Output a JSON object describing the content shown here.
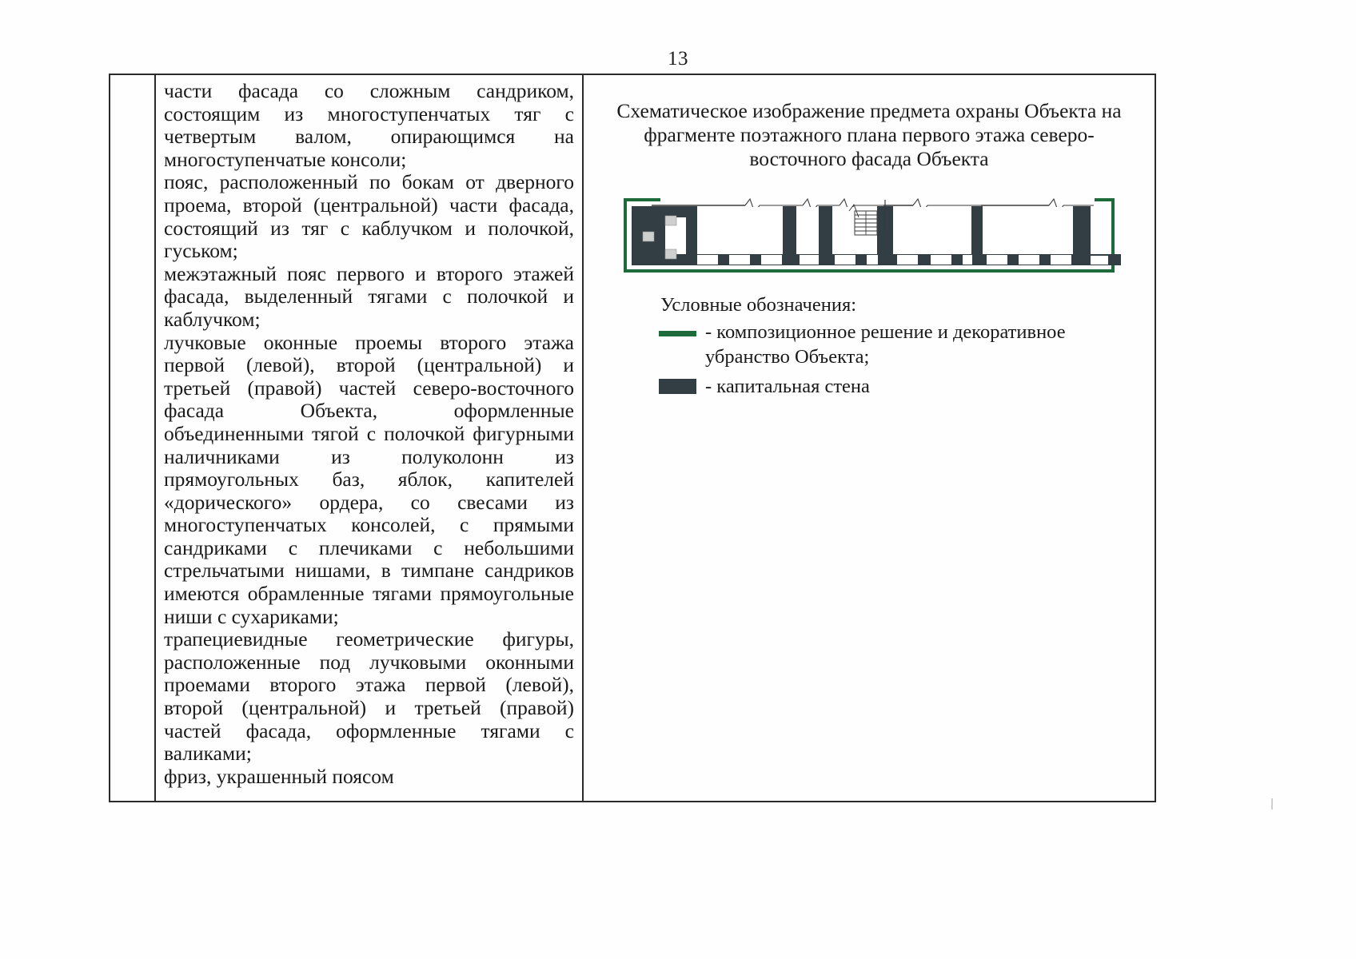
{
  "page": {
    "number": "13"
  },
  "text_column": {
    "paragraphs": [
      "части фасада со сложным сандриком, состоящим из многоступенчатых тяг с четвертым валом, опирающимся на многоступенчатые консоли;",
      "пояс, расположенный по бокам от дверного проема, второй (центральной) части фасада, состоящий из тяг с каблучком и полочкой, гуськом;",
      "межэтажный пояс первого и второго этажей фасада, выделенный тягами с полочкой и каблучком;",
      "лучковые оконные проемы второго этажа первой (левой), второй (центральной) и третьей (правой) частей северо-восточного фасада Объекта, оформленные объединенными тягой с полочкой фигурными наличниками из полуколонн из прямоугольных баз, яблок, капителей «дорического» ордера, со свесами из многоступенчатых консолей, с прямыми сандриками с плечиками с небольшими стрельчатыми нишами, в тимпане сандриков имеются обрамленные тягами прямоугольные ниши с сухариками;",
      "трапециевидные геометрические фигуры, расположенные под лучковыми оконными проемами второго этажа первой (левой), второй (центральной) и третьей (правой) частей фасада, оформленные тягами с валиками;",
      "фриз, украшенный поясом"
    ]
  },
  "figure": {
    "title": "Схематическое изображение предмета охраны Объекта на фрагменте поэтажного плана первого этажа северо-восточного фасада Объекта",
    "legend": {
      "title": "Условные обозначения:",
      "items": [
        {
          "swatch": "green-line",
          "label": "- композиционное решение и декоративное убранство Объекта;"
        },
        {
          "swatch": "dark-block",
          "label": "- капитальная стена"
        }
      ]
    },
    "colors": {
      "protection_green": "#1d6b3a",
      "wall_dark": "#323d44",
      "outline": "#2b2b2b"
    }
  }
}
